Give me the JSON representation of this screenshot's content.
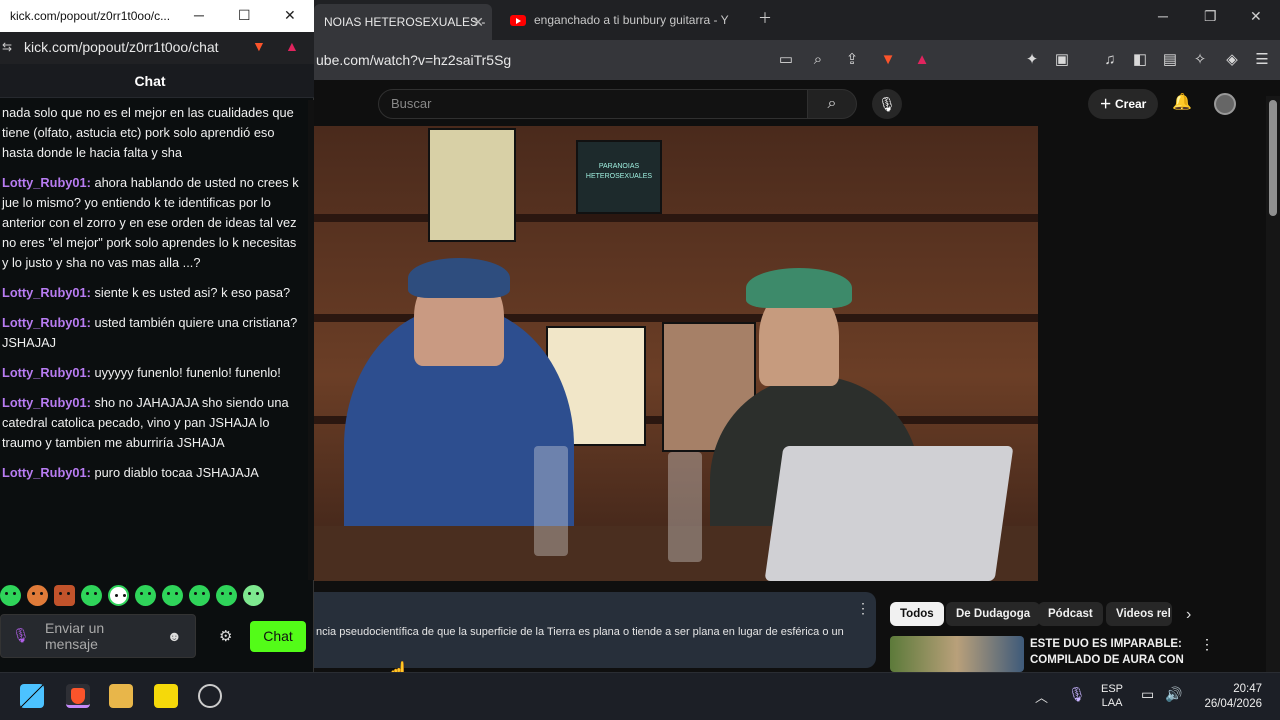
{
  "browser": {
    "tabs": [
      {
        "title": "NOIAS HETEROSEXUALES -"
      },
      {
        "title": "enganchado a ti bunbury guitarra - Y"
      }
    ],
    "url": "ube.com/watch?v=hz2saiTr5Sg"
  },
  "youtube": {
    "search_placeholder": "Buscar",
    "create_label": "Crear",
    "description": "ncia pseudocientífica de que la superficie de la Tierra es plana o tiende a ser plana en lugar de esférica o un",
    "chips": [
      "Todos",
      "De Dudagoga",
      "Pódcast",
      "Videos rel"
    ],
    "recommended": {
      "title": "ESTE DUO ES IMPARABLE: COMPILADO DE AURA CON ..."
    },
    "video_poster_text": "PARANOIAS HETEROSEXUALES"
  },
  "chat_window": {
    "title": "kick.com/popout/z0rr1t0oo/c...",
    "url": "kick.com/popout/z0rr1t0oo/chat",
    "header": "Chat",
    "messages": [
      {
        "user": "",
        "text": "nada solo que no es el mejor en las cualidades que tiene (olfato, astucia etc) pork solo aprendió eso hasta donde le hacia falta y sha"
      },
      {
        "user": "Lotty_Ruby01",
        "text": " ahora hablando de usted no crees k jue lo mismo? yo entiendo k te identificas por lo anterior con el zorro y en ese orden de ideas tal vez no eres \"el mejor\" pork solo aprendes lo k necesitas y lo justo y sha no vas mas alla ...?"
      },
      {
        "user": "Lotty_Ruby01",
        "text": " siente k es usted asi? k eso pasa?"
      },
      {
        "user": "Lotty_Ruby01",
        "text": " usted también quiere una cristiana? JSHAJAJ"
      },
      {
        "user": "Lotty_Ruby01",
        "text": " uyyyyy funenlo! funenlo! funenlo!"
      },
      {
        "user": "Lotty_Ruby01",
        "text": " sho no JAHAJAJA sho siendo una catedral catolica pecado, vino y pan JSHAJA lo traumo y tambien me aburriría JSHAJA"
      },
      {
        "user": "Lotty_Ruby01",
        "text": " puro diablo tocaa JSHAJAJA"
      }
    ],
    "input_placeholder": "Enviar un mensaje",
    "send_label": "Chat",
    "colors": {
      "accent": "#53fc18",
      "username": "#b87cf2"
    }
  },
  "taskbar": {
    "lang_line1": "ESP",
    "lang_line2": "LAA",
    "time": "20:47",
    "date": "26/04/2026"
  }
}
